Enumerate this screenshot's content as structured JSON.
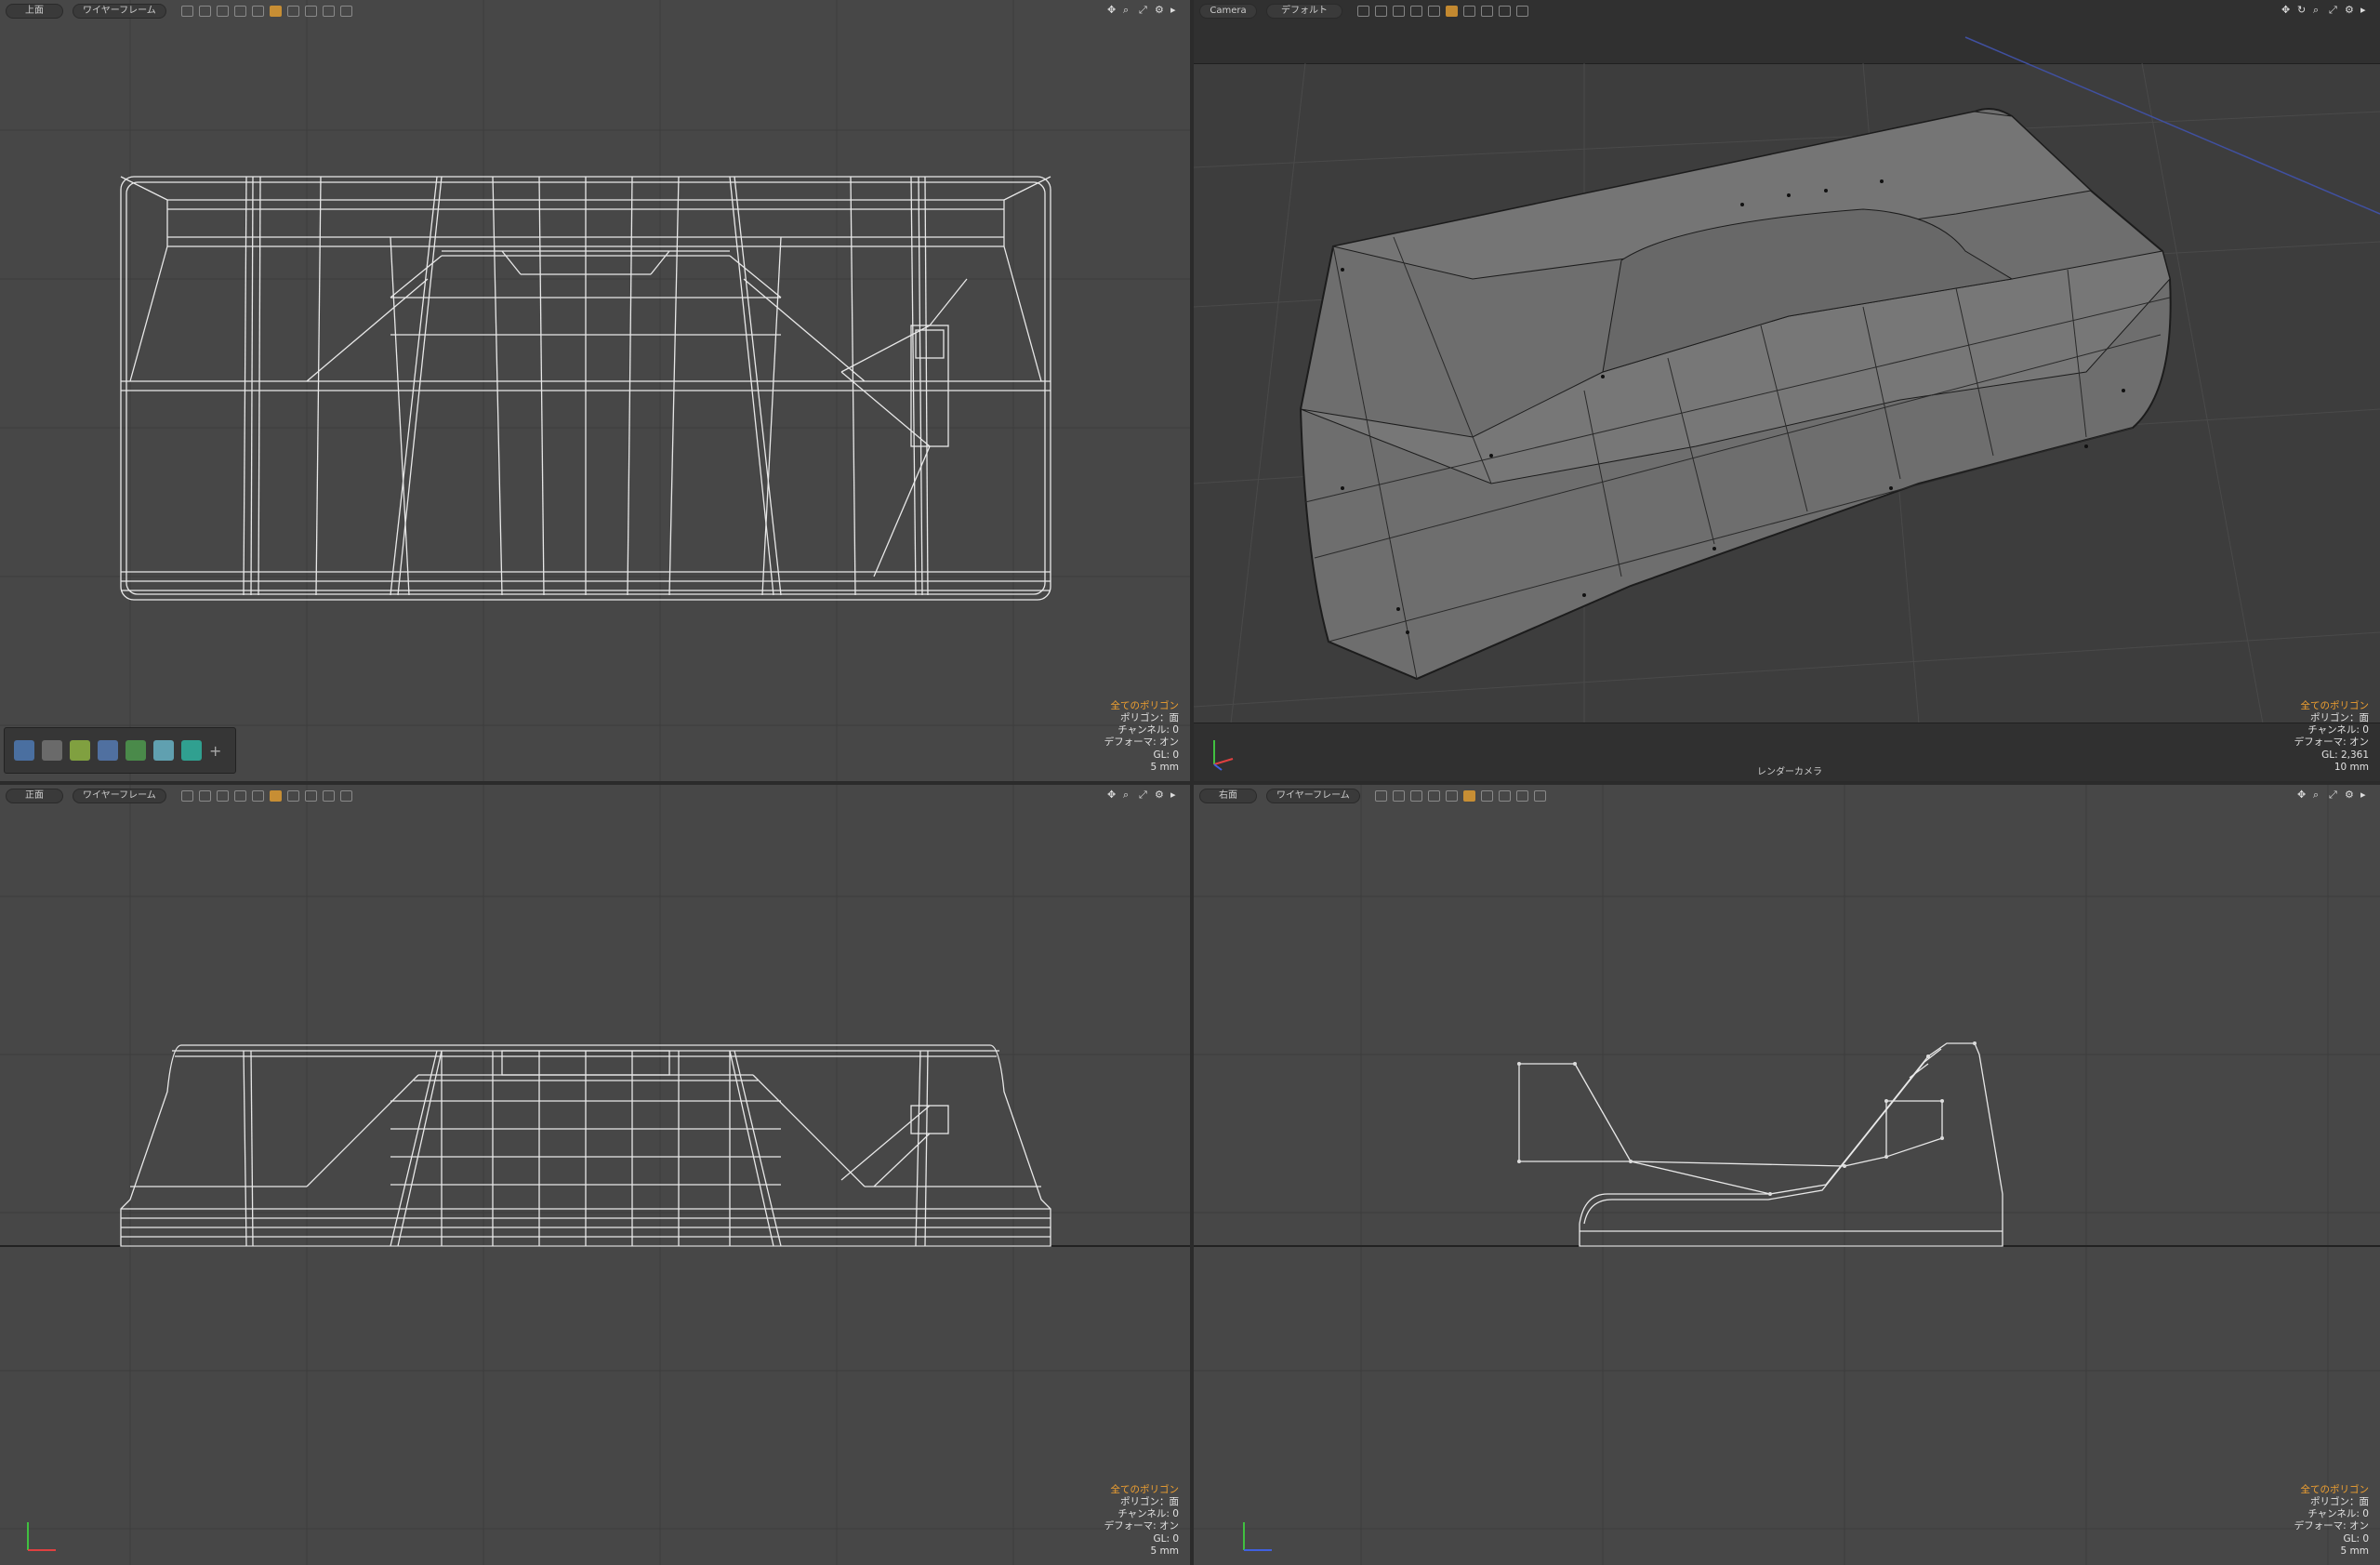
{
  "viewports": {
    "top": {
      "view_label": "上面",
      "shade_label": "ワイヤーフレーム",
      "info": {
        "polys": "全てのポリゴン",
        "poly_mode": "ポリゴン：面",
        "channels": "チャンネル: 0",
        "deformers": "デフォーマ: オン",
        "gl": "GL: 0",
        "scale": "5 mm"
      }
    },
    "camera": {
      "view_label": "Camera",
      "shade_label": "デフォルト",
      "caption": "レンダーカメラ",
      "info": {
        "polys": "全てのポリゴン",
        "poly_mode": "ポリゴン：面",
        "channels": "チャンネル: 0",
        "deformers": "デフォーマ: オン",
        "gl": "GL: 2,361",
        "scale": "10 mm"
      }
    },
    "front": {
      "view_label": "正面",
      "shade_label": "ワイヤーフレーム",
      "info": {
        "polys": "全てのポリゴン",
        "poly_mode": "ポリゴン：面",
        "channels": "チャンネル: 0",
        "deformers": "デフォーマ: オン",
        "gl": "GL: 0",
        "scale": "5 mm"
      }
    },
    "right": {
      "view_label": "右面",
      "shade_label": "ワイヤーフレーム",
      "info": {
        "polys": "全てのポリゴン",
        "poly_mode": "ポリゴン：面",
        "channels": "チャンネル: 0",
        "deformers": "デフォーマ: オン",
        "gl": "GL: 0",
        "scale": "5 mm"
      }
    }
  },
  "toolbox": {
    "tools": [
      "move-tool-icon",
      "hand-tool-icon",
      "transform-tool-icon",
      "box-tool-icon",
      "paint-tool-icon",
      "cube-tool-icon",
      "layer-tool-icon",
      "add-icon"
    ]
  },
  "colors": {
    "accent": "#f0a030",
    "viewport_bg": "#474747",
    "wire": "#e8e8e8",
    "x_axis": "#e04040",
    "y_axis": "#40c040",
    "z_axis": "#4060e0"
  }
}
